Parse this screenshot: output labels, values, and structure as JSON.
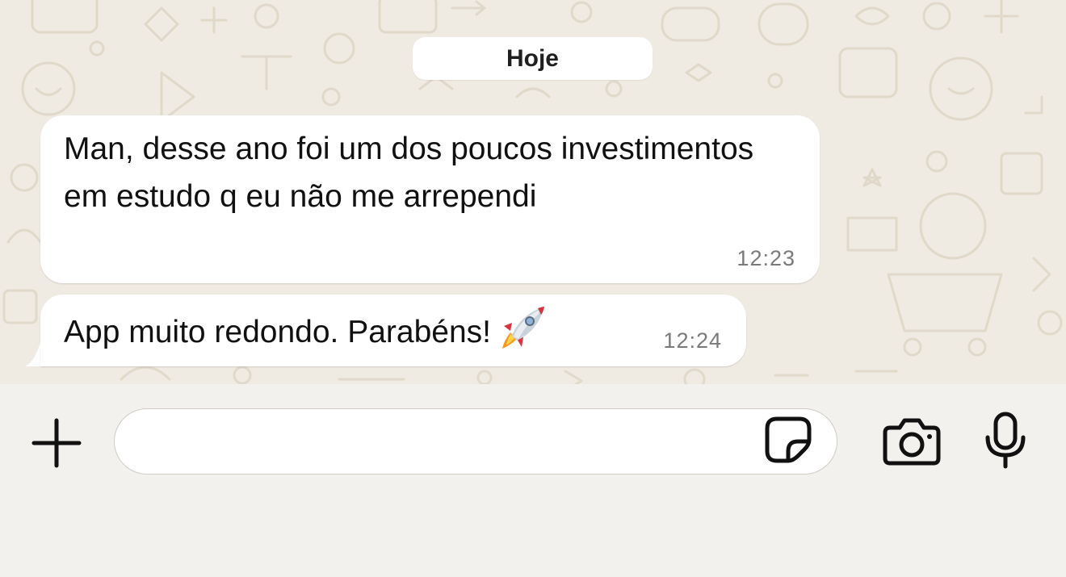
{
  "chat": {
    "date_label": "Hoje",
    "messages": [
      {
        "text": "Man, desse ano foi um dos poucos investimentos em estudo q eu não me arrependi",
        "time": "12:23"
      },
      {
        "text": "App muito redondo. Parabéns!",
        "emoji": "rocket-emoji",
        "time": "12:24"
      }
    ]
  },
  "composer": {
    "input_value": "",
    "input_placeholder": "",
    "icons": {
      "attach": "plus-icon",
      "sticker": "sticker-icon",
      "camera": "camera-icon",
      "voice": "microphone-icon"
    }
  },
  "colors": {
    "chat_background": "#EFEAE2",
    "bubble": "#FFFFFF",
    "composer_background": "#F3F1EE",
    "timestamp": "#7A7A7A"
  }
}
